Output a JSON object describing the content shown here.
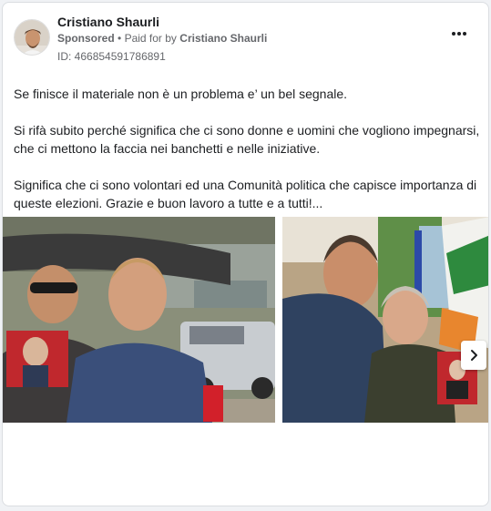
{
  "advertiser": {
    "name": "Cristiano Shaurli",
    "sponsored_label": "Sponsored",
    "separator": "•",
    "paid_for_label": "Paid for by",
    "payer": "Cristiano Shaurli",
    "ad_id": "ID: 466854591786891"
  },
  "post": {
    "paragraphs": [
      "Se finisce il materiale non è un problema e’ un bel segnale.",
      "Si rifà subito perché significa che ci sono donne e uomini che vogliono impegnarsi, che ci mettono la faccia nei banchetti e nelle iniziative.",
      "Significa che ci sono volontari ed una Comunità politica che capisce importanza di queste elezioni. Grazie e buon lavoro a tutte e a tutti!..."
    ]
  },
  "icons": {
    "more": "more-options-icon",
    "next": "chevron-right-icon"
  },
  "colors": {
    "name": "#1c1e21",
    "secondary": "#65676b",
    "border": "#dadde1"
  }
}
